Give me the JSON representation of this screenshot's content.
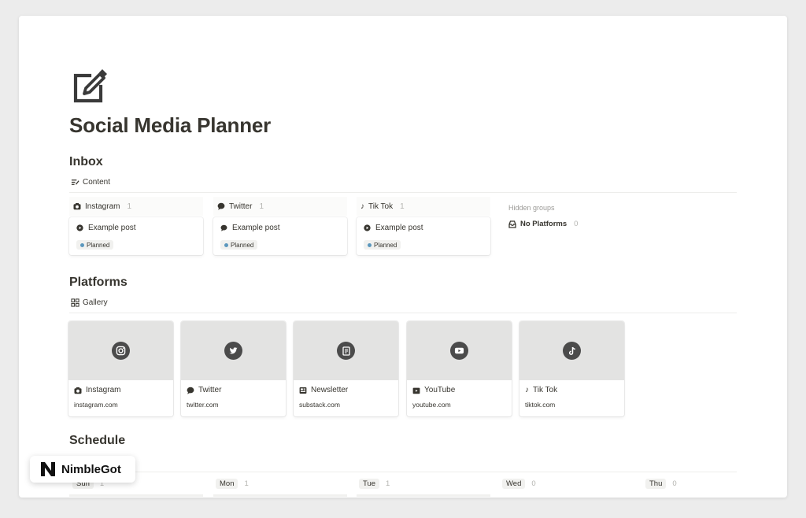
{
  "page": {
    "title": "Social Media Planner"
  },
  "inbox": {
    "heading": "Inbox",
    "view_label": "Content",
    "columns": [
      {
        "name": "Instagram",
        "count": "1",
        "card_title": "Example post",
        "status": "Planned"
      },
      {
        "name": "Twitter",
        "count": "1",
        "card_title": "Example post",
        "status": "Planned"
      },
      {
        "name": "Tik Tok",
        "count": "1",
        "card_title": "Example post",
        "status": "Planned"
      }
    ],
    "hidden_label": "Hidden groups",
    "hidden_item": {
      "name": "No Platforms",
      "count": "0"
    }
  },
  "platforms": {
    "heading": "Platforms",
    "view_label": "Gallery",
    "cards": [
      {
        "name": "Instagram",
        "url": "instagram.com",
        "icon": "instagram-icon"
      },
      {
        "name": "Twitter",
        "url": "twitter.com",
        "icon": "twitter-icon"
      },
      {
        "name": "Newsletter",
        "url": "substack.com",
        "icon": "newsletter-icon"
      },
      {
        "name": "YouTube",
        "url": "youtube.com",
        "icon": "youtube-icon"
      },
      {
        "name": "Tik Tok",
        "url": "tiktok.com",
        "icon": "tiktok-icon"
      }
    ]
  },
  "schedule": {
    "heading": "Schedule",
    "days": [
      {
        "label": "Sun",
        "count": "1"
      },
      {
        "label": "Mon",
        "count": "1"
      },
      {
        "label": "Tue",
        "count": "1"
      },
      {
        "label": "Wed",
        "count": "0"
      },
      {
        "label": "Thu",
        "count": "0"
      }
    ]
  },
  "watermark": {
    "brand": "NimbleGot"
  },
  "colors": {
    "status_dot": "#5b97bd",
    "cover_bg": "#e3e3e2",
    "text": "#37352f"
  }
}
